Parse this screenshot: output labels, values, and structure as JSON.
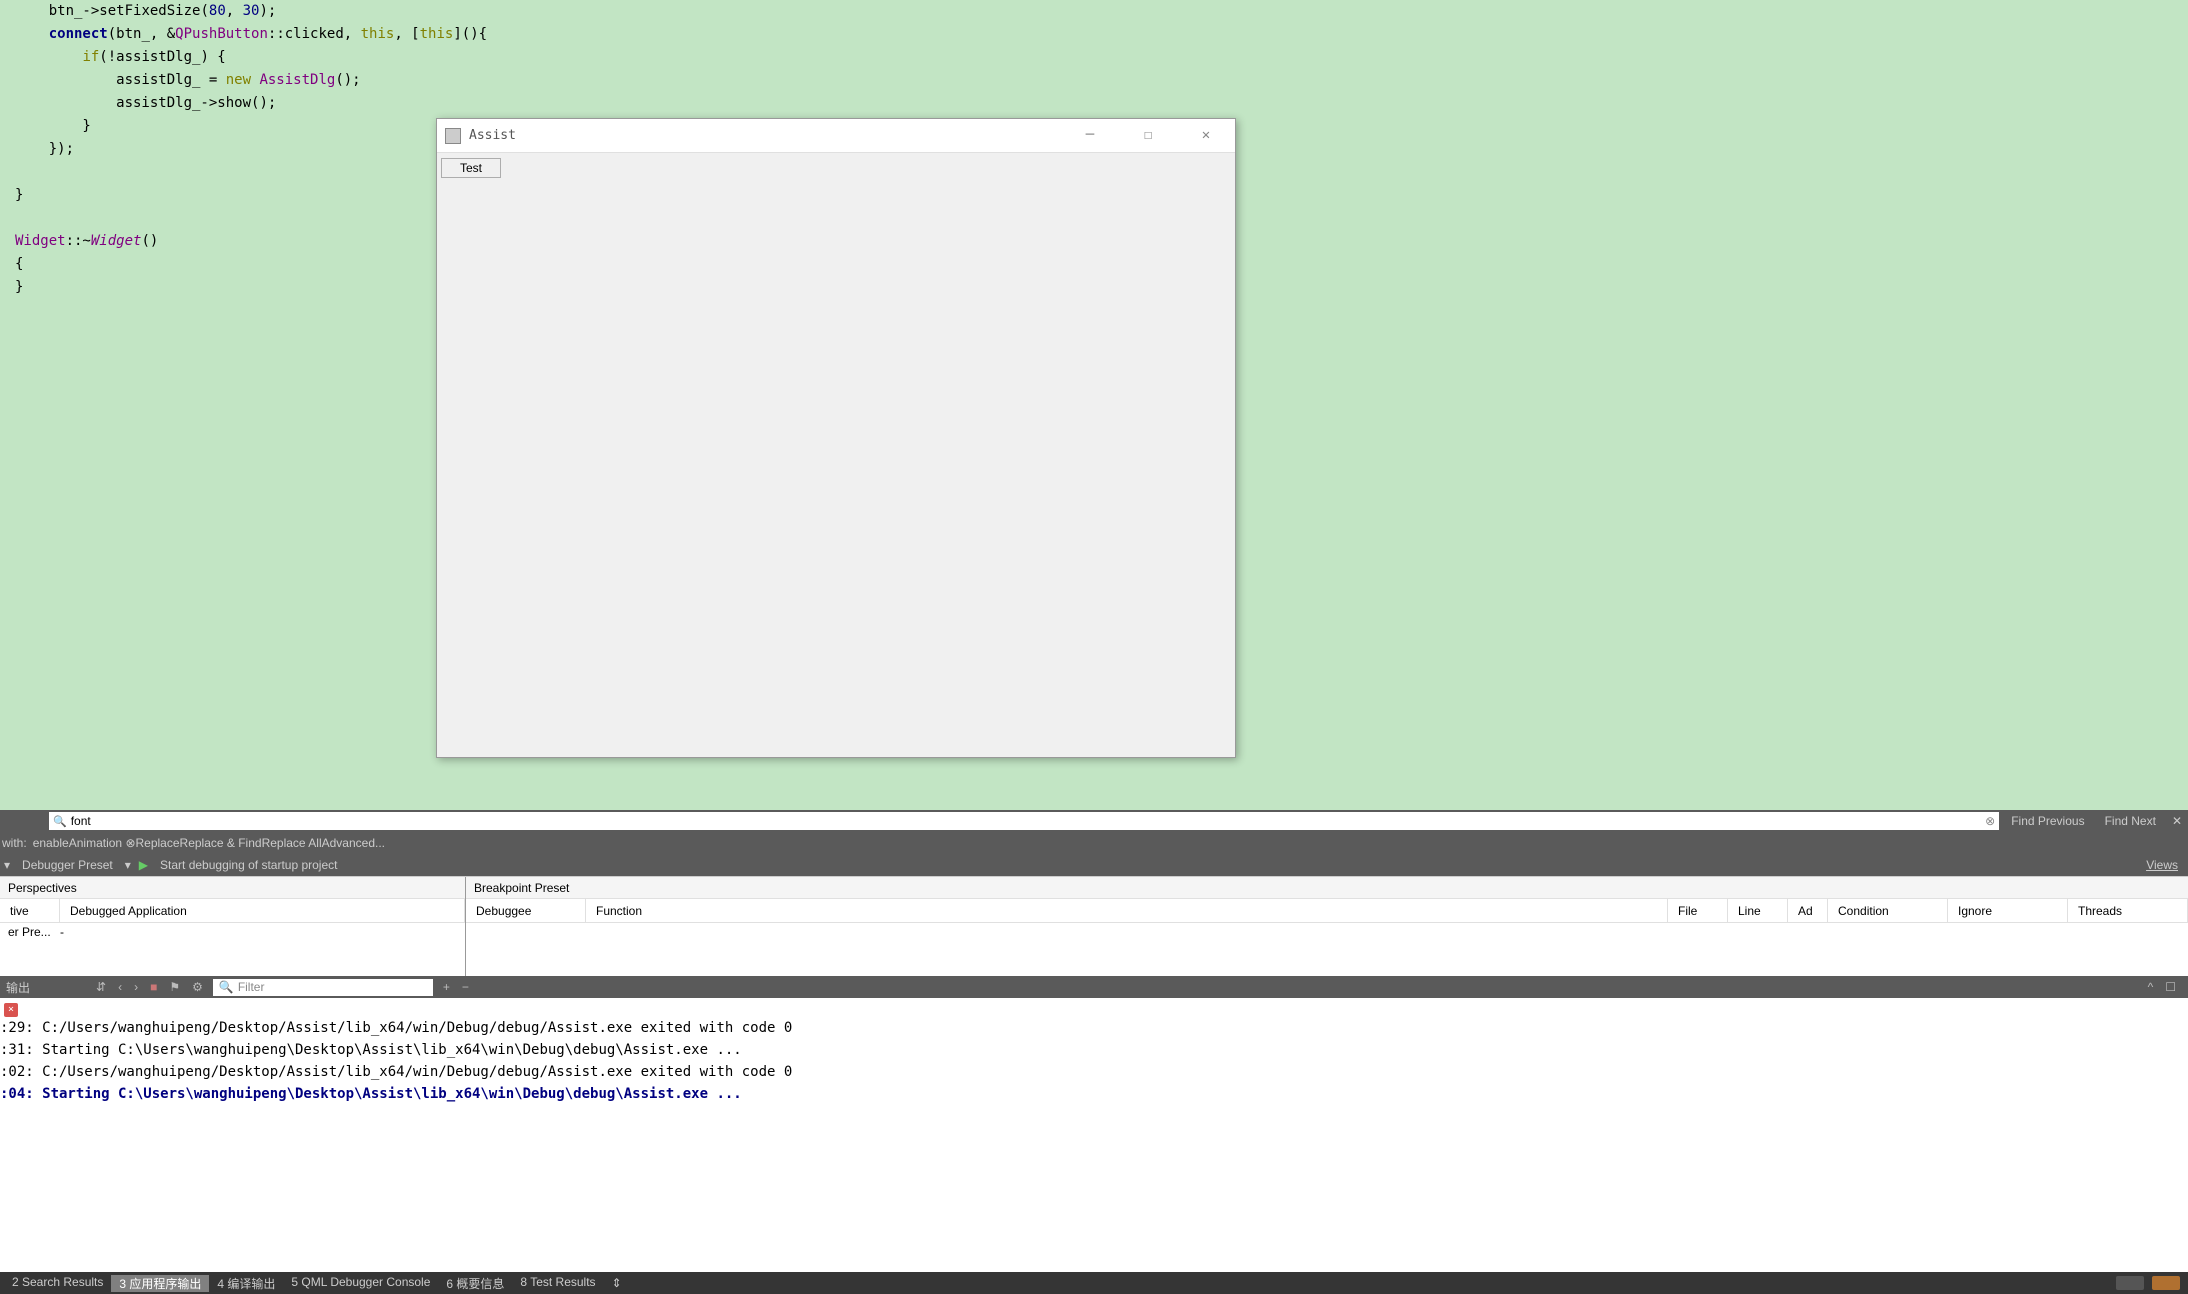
{
  "code": {
    "lines": [
      {
        "type": "raw",
        "html": "    btn_-><span class='func'>setFixedSize</span>(<span class='num'>80</span>, <span class='num'>30</span>);"
      },
      {
        "type": "raw",
        "html": "    <span class='dark'>connect</span>(btn_, &<span class='type'>QPushButton</span>::clicked, <span class='kw'>this</span>, [<span class='kw'>this</span>](){"
      },
      {
        "type": "raw",
        "html": "        <span class='kw'>if</span>(!assistDlg_) {"
      },
      {
        "type": "raw",
        "html": "            assistDlg_ = <span class='kw'>new</span> <span class='type'>AssistDlg</span>();"
      },
      {
        "type": "raw",
        "html": "            assistDlg_-><span class='func'>show</span>();"
      },
      {
        "type": "raw",
        "html": "        }"
      },
      {
        "type": "raw",
        "html": "    });"
      },
      {
        "type": "raw",
        "html": ""
      },
      {
        "type": "raw",
        "html": "}"
      },
      {
        "type": "raw",
        "html": ""
      },
      {
        "type": "raw",
        "html": "<span class='type'>Widget</span>::~<span class='type ital'>Widget</span>()"
      },
      {
        "type": "raw",
        "html": "{"
      },
      {
        "type": "raw",
        "html": "}"
      }
    ]
  },
  "floating_window": {
    "title": "Assist",
    "button_label": "Test"
  },
  "find": {
    "search_value": "font",
    "replace_label": "with:",
    "replace_value": "enableAnimation",
    "find_prev": "Find Previous",
    "find_next": "Find Next",
    "replace": "Replace",
    "replace_find": "Replace & Find",
    "replace_all": "Replace All",
    "advanced": "Advanced..."
  },
  "debugbar": {
    "preset": "Debugger Preset",
    "start_text": "Start debugging of startup project",
    "views": "Views"
  },
  "panels": {
    "left_header": "Perspectives",
    "right_header": "Breakpoint Preset",
    "left_cols": [
      "tive",
      "Debugged Application"
    ],
    "left_row": [
      "er Pre...",
      "-"
    ],
    "right_cols": [
      "Debuggee",
      "Function",
      "File",
      "Line",
      "Ad",
      "Condition",
      "Ignore",
      "Threads"
    ]
  },
  "output": {
    "header_label": "输出",
    "filter_placeholder": "Filter",
    "lines": [
      {
        "prefix": ":29: ",
        "text": "C:/Users/wanghuipeng/Desktop/Assist/lib_x64/win/Debug/debug/Assist.exe exited with code 0",
        "cls": ""
      },
      {
        "prefix": "",
        "text": "",
        "cls": ""
      },
      {
        "prefix": ":31: ",
        "text": "Starting C:\\Users\\wanghuipeng\\Desktop\\Assist\\lib_x64\\win\\Debug\\debug\\Assist.exe ...",
        "cls": ""
      },
      {
        "prefix": ":02: ",
        "text": "C:/Users/wanghuipeng/Desktop/Assist/lib_x64/win/Debug/debug/Assist.exe exited with code 0",
        "cls": ""
      },
      {
        "prefix": "",
        "text": "",
        "cls": ""
      },
      {
        "prefix": ":04: ",
        "text": "Starting C:\\Users\\wanghuipeng\\Desktop\\Assist\\lib_x64\\win\\Debug\\debug\\Assist.exe ...",
        "cls": "bold-blue"
      }
    ]
  },
  "bottombar": {
    "tabs": [
      {
        "label": "2 Search Results",
        "active": false
      },
      {
        "label": "3 应用程序输出",
        "active": true
      },
      {
        "label": "4 编译输出",
        "active": false
      },
      {
        "label": "5 QML Debugger Console",
        "active": false
      },
      {
        "label": "6 概要信息",
        "active": false
      },
      {
        "label": "8 Test Results",
        "active": false
      }
    ]
  }
}
